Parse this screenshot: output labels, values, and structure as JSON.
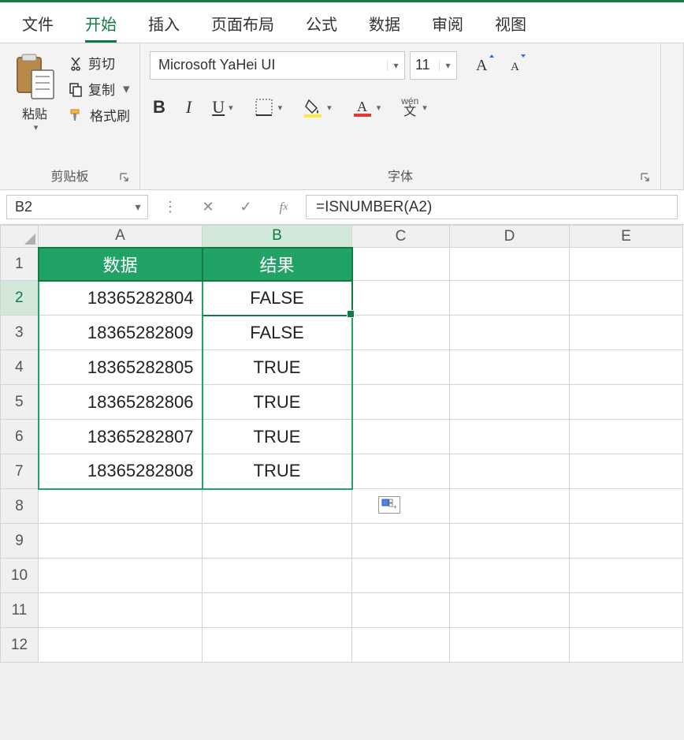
{
  "ribbon_tabs": {
    "file": "文件",
    "home": "开始",
    "insert": "插入",
    "page_layout": "页面布局",
    "formulas": "公式",
    "data": "数据",
    "review": "审阅",
    "view": "视图"
  },
  "clipboard": {
    "paste": "粘贴",
    "cut": "剪切",
    "copy": "复制",
    "format_painter": "格式刷",
    "group_label": "剪贴板"
  },
  "font": {
    "name": "Microsoft YaHei UI",
    "size": "11",
    "phonetic_top": "wén",
    "phonetic_bottom": "文",
    "group_label": "字体"
  },
  "name_box": "B2",
  "formula": "=ISNUMBER(A2)",
  "columns": [
    "A",
    "B",
    "C",
    "D",
    "E"
  ],
  "row_numbers": [
    "1",
    "2",
    "3",
    "4",
    "5",
    "6",
    "7",
    "8",
    "9",
    "10",
    "11",
    "12"
  ],
  "table": {
    "headers": {
      "col_a": "数据",
      "col_b": "结果"
    },
    "rows": [
      {
        "data": "18365282804",
        "result": "FALSE"
      },
      {
        "data": "18365282809",
        "result": "FALSE"
      },
      {
        "data": "18365282805",
        "result": "TRUE"
      },
      {
        "data": "18365282806",
        "result": "TRUE"
      },
      {
        "data": "18365282807",
        "result": "TRUE"
      },
      {
        "data": "18365282808",
        "result": "TRUE"
      }
    ]
  },
  "colors": {
    "accent": "#107c41",
    "header_bg": "#21a366"
  }
}
